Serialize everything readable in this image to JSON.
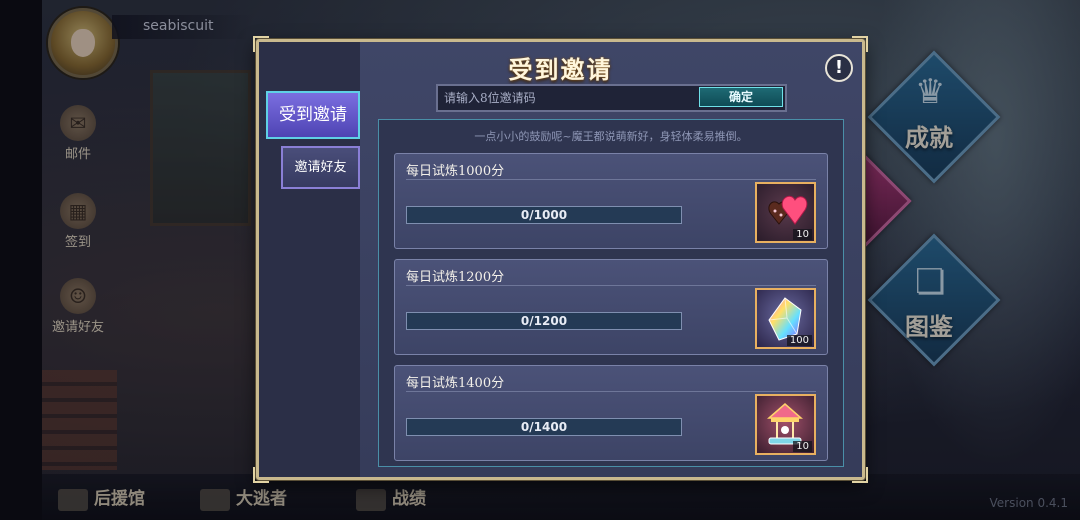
{
  "player": {
    "name": "seabiscuit"
  },
  "side_menu": {
    "mail": "邮件",
    "sign_in": "签到",
    "invite_friends": "邀请好友"
  },
  "right_menu": {
    "achievements": "成就",
    "codex": "图鉴"
  },
  "bottom_nav": {
    "support_hall": "后援馆",
    "raid": "大逃者",
    "records": "战绩"
  },
  "version": "Version 0.4.1",
  "dialog": {
    "title": "受到邀请",
    "help": "!",
    "tabs": [
      {
        "label": "受到邀请",
        "active": true
      },
      {
        "label": "邀请好友",
        "active": false
      }
    ],
    "invite_code": {
      "placeholder": "请输入8位邀请码",
      "value": "",
      "confirm_label": "确定"
    },
    "hint": "一点小小的鼓励呢~魔王都说萌新好，身轻体柔易推倒。",
    "tasks": [
      {
        "title": "每日试炼1000分",
        "current": 0,
        "target": 1000,
        "progress_text": "0/1000",
        "reward": {
          "icon": "chocolate-heart-icon",
          "count": "10"
        }
      },
      {
        "title": "每日试炼1200分",
        "current": 0,
        "target": 1200,
        "progress_text": "0/1200",
        "reward": {
          "icon": "rainbow-crystal-icon",
          "count": "100"
        }
      },
      {
        "title": "每日试炼1400分",
        "current": 0,
        "target": 1400,
        "progress_text": "0/1400",
        "reward": {
          "icon": "carousel-icon",
          "count": "10"
        }
      }
    ]
  },
  "colors": {
    "dialog_bg": "#3f4667",
    "gold_border": "#c9b98e",
    "active_tab": "#6a5fd6",
    "confirm_button": "#1e6a74",
    "progress_track": "#243a55"
  }
}
